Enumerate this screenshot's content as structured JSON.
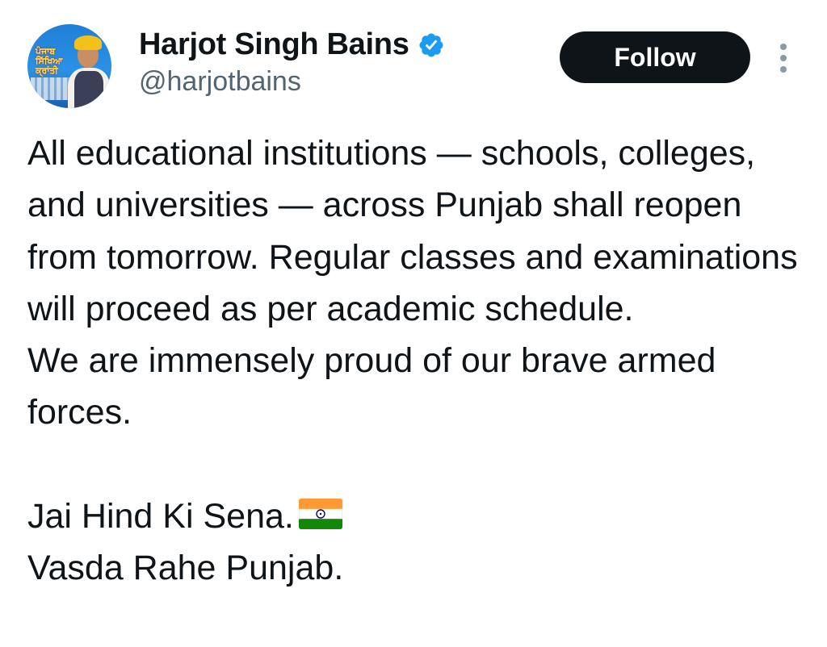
{
  "author": {
    "display_name": "Harjot Singh Bains",
    "handle": "@harjotbains",
    "avatar_icon": "profile-photo",
    "avatar_text": "ਪੰਜਾਬ ਸਿੱਖਿਆ ਕ੍ਰਾਂਤੀ",
    "verified_icon": "verified-badge-icon",
    "verified_color": "#1d9bf0"
  },
  "actions": {
    "follow_label": "Follow",
    "follow_bg": "#0f1419",
    "more_icon": "more-vertical-icon"
  },
  "tweet": {
    "paragraph_1": "All educational institutions — schools, colleges, and universities — across Punjab shall reopen from tomorrow. Regular classes and examinations will proceed as per academic schedule.",
    "paragraph_2": "We are immensely proud of our brave armed forces.",
    "line_3": "Jai Hind Ki Sena.",
    "flag_icon": "india-flag-icon",
    "line_4": "Vasda Rahe Punjab."
  }
}
